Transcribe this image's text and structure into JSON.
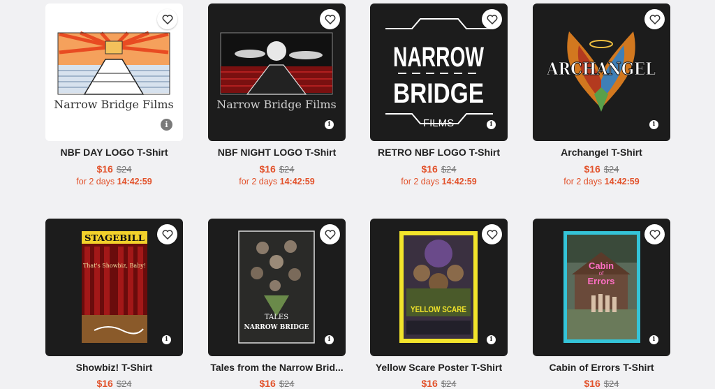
{
  "accent_color": "#e2522b",
  "products": [
    {
      "title": "NBF DAY LOGO T-Shirt",
      "price": "$16",
      "old_price": "$24",
      "timer_prefix": "for 2 days",
      "timer": "14:42:59",
      "art_text": "Narrow Bridge Films"
    },
    {
      "title": "NBF NIGHT LOGO T-Shirt",
      "price": "$16",
      "old_price": "$24",
      "timer_prefix": "for 2 days",
      "timer": "14:42:59",
      "art_text": "Narrow Bridge Films"
    },
    {
      "title": "RETRO NBF LOGO T-Shirt",
      "price": "$16",
      "old_price": "$24",
      "timer_prefix": "for 2 days",
      "timer": "14:42:59",
      "art_line1": "NARROW",
      "art_line2": "BRIDGE",
      "art_line3": "FILMS"
    },
    {
      "title": "Archangel T-Shirt",
      "price": "$16",
      "old_price": "$24",
      "timer_prefix": "for 2 days",
      "timer": "14:42:59",
      "art_text": "ARCHANGEL"
    },
    {
      "title": "Showbiz! T-Shirt",
      "price": "$16",
      "old_price": "$24",
      "art_line1": "STAGEBILL",
      "art_line2": "That's Showbiz, Baby!"
    },
    {
      "title": "Tales from the Narrow Brid...",
      "price": "$16",
      "old_price": "$24",
      "art_line1": "TALES",
      "art_line2": "NARROW BRIDGE"
    },
    {
      "title": "Yellow Scare Poster T-Shirt",
      "price": "$16",
      "old_price": "$24",
      "art_text": "YELLOW SCARE"
    },
    {
      "title": "Cabin of Errors T-Shirt",
      "price": "$16",
      "old_price": "$24",
      "art_line1": "Cabin",
      "art_line2": "of",
      "art_line3": "Errors"
    }
  ]
}
